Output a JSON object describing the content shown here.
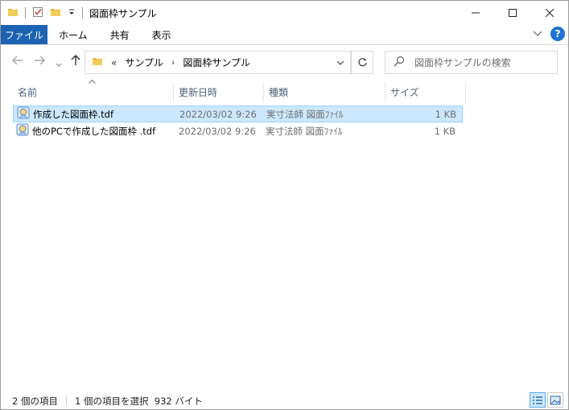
{
  "window": {
    "title": "図面枠サンプル"
  },
  "ribbon": {
    "tabs": [
      "ファイル",
      "ホーム",
      "共有",
      "表示"
    ]
  },
  "address": {
    "overflow": "«",
    "segments": [
      "サンプル",
      "図面枠サンプル"
    ]
  },
  "search": {
    "placeholder": "図面枠サンプルの検索"
  },
  "columns": [
    "名前",
    "更新日時",
    "種類",
    "サイズ"
  ],
  "files": [
    {
      "name": "作成した図面枠.tdf",
      "date": "2022/03/02 9:26",
      "type": "実寸法師 図面ﾌｧｲﾙ",
      "size": "1 KB",
      "selected": true
    },
    {
      "name": "他のPCで作成した図面枠 .tdf",
      "date": "2022/03/02 9:26",
      "type": "実寸法師 図面ﾌｧｲﾙ",
      "size": "1 KB",
      "selected": false
    }
  ],
  "status": {
    "item_count": "2 個の項目",
    "selection": "1 個の項目を選択  932 バイト"
  },
  "colors": {
    "file_tab": "#1e63b3",
    "selection_bg": "#cce8ff",
    "selection_border": "#99d1ff",
    "header_text": "#4c607a"
  },
  "icons": {
    "folder": "folder-icon",
    "properties": "properties-icon",
    "back": "arrow-left-icon",
    "forward": "arrow-right-icon",
    "up": "arrow-up-icon",
    "refresh": "refresh-icon",
    "search": "search-icon",
    "help": "help-icon",
    "file": "tdf-file-icon"
  }
}
